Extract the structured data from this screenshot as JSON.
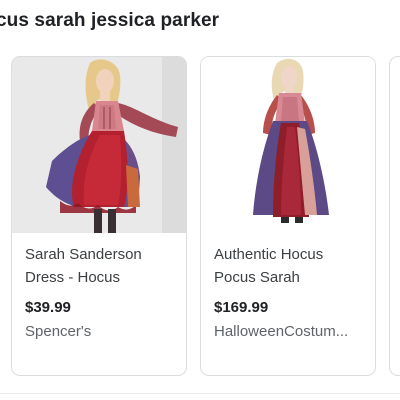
{
  "search": {
    "heading": "cus sarah jessica parker"
  },
  "results": [
    {
      "title": "Sarah Sanderson Dress - Hocus",
      "price": "$39.99",
      "merchant": "Spencer's",
      "image_icon": "costume-photo-red-purple-dress"
    },
    {
      "title": "Authentic Hocus Pocus Sarah",
      "price": "$169.99",
      "merchant": "HalloweenCostum...",
      "image_icon": "costume-photo-long-gown"
    }
  ],
  "colors": {
    "border": "#dadce0",
    "title_text": "#3c4043",
    "merchant_text": "#5f6368",
    "price_text": "#202124"
  }
}
